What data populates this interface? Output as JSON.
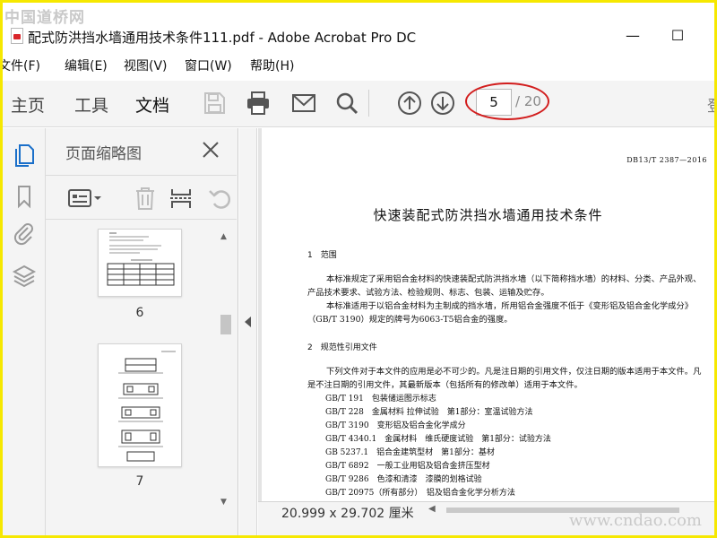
{
  "watermark": {
    "top": "中国道桥网",
    "bottom": "www.cndao.com"
  },
  "window": {
    "title": "配式防洪挡水墙通用技术条件111.pdf - Adobe Acrobat Pro DC",
    "minimize": "—",
    "maximize": "☐"
  },
  "menu": [
    "文件(F)",
    "编辑(E)",
    "视图(V)",
    "窗口(W)",
    "帮助(H)"
  ],
  "toolbar": {
    "tabs": [
      "主页",
      "工具",
      "文档"
    ],
    "active_tab": "文档",
    "page_current": "5",
    "page_total": "/ 20",
    "cut_glyph": "登",
    "highlight_color": "#d21d1d"
  },
  "panel": {
    "title": "页面缩略图",
    "thumbnails": [
      {
        "number": "6"
      },
      {
        "number": "7"
      }
    ]
  },
  "document": {
    "standard_code": "DB13/T 2387—2016",
    "title": "快速装配式防洪挡水墙通用技术条件",
    "section1": "1　范围",
    "para1": "本标准规定了采用铝合金材料的快速装配式防洪挡水墙（以下简称挡水墙）的材料、分类、产品外观、产品技术要求、试验方法、检验规则、标志、包装、运输及贮存。",
    "para2": "本标准适用于以铝合金材料为主制成的挡水墙，所用铝合金强度不低于《变形铝及铝合金化学成分》（GB/T 3190）规定的牌号为6063-T5铝合金的强度。",
    "section2": "2　规范性引用文件",
    "para3": "下列文件对于本文件的应用是必不可少的。凡是注日期的引用文件，仅注日期的版本适用于本文件。凡是不注日期的引用文件，其最新版本（包括所有的修改单）适用于本文件。",
    "references": [
      "GB/T 191　包装储运图示标志",
      "GB/T 228　金属材料 拉伸试验　第1部分：室温试验方法",
      "GB/T 3190　变形铝及铝合金化学成分",
      "GB/T 4340.1　金属材料　维氏硬度试验　第1部分：试验方法",
      "GB 5237.1　铝合金建筑型材　第1部分：基材",
      "GB/T 6892　一般工业用铝及铝合金挤压型材",
      "GB/T 9286　色漆和清漆　漆膜的划格试验",
      "GB/T 20975（所有部分）　铝及铝合金化学分析方法"
    ]
  },
  "status": {
    "page_size": "20.999 x 29.702 厘米"
  }
}
